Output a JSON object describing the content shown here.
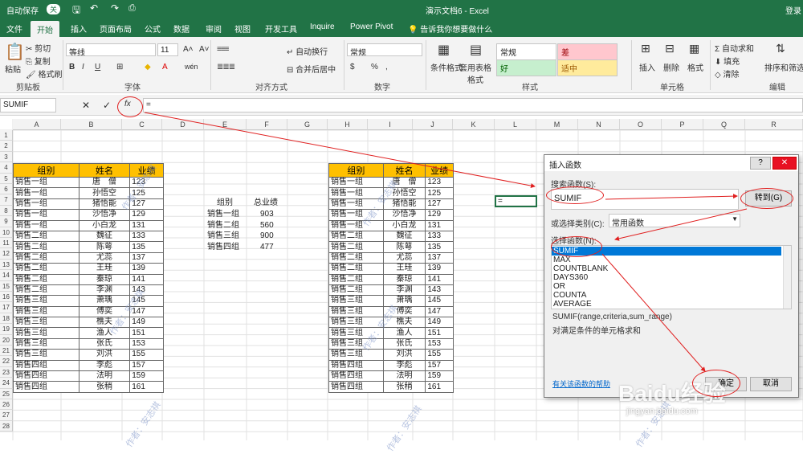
{
  "titlebar": {
    "autosave": "自动保存",
    "autosave_state": "关",
    "doc_title": "演示文档6  -  Excel",
    "login": "登录"
  },
  "tabs": [
    "文件",
    "开始",
    "插入",
    "页面布局",
    "公式",
    "数据",
    "审阅",
    "视图",
    "开发工具",
    "Inquire",
    "Power Pivot",
    "告诉我你想要做什么"
  ],
  "ribbon": {
    "clipboard": {
      "paste": "粘贴",
      "cut": "剪切",
      "copy": "复制",
      "format_painter": "格式刷",
      "group": "剪贴板"
    },
    "font": {
      "name": "等线",
      "size": "11",
      "group": "字体",
      "bold": "B",
      "italic": "I",
      "underline": "U",
      "grow": "A˄",
      "shrink": "A˅",
      "wen": "wén"
    },
    "alignment": {
      "wrap": "自动换行",
      "merge": "合并后居中",
      "group": "对齐方式"
    },
    "number": {
      "format": "常规",
      "group": "数字",
      "percent": "%",
      "comma": ","
    },
    "styles": {
      "conditional": "条件格式",
      "table": "套用表格格式",
      "normal": "常规",
      "bad": "差",
      "good": "好",
      "neutral": "适中",
      "group": "样式"
    },
    "cells": {
      "insert": "插入",
      "delete": "删除",
      "format": "格式",
      "group": "单元格"
    },
    "editing": {
      "autosum": "自动求和",
      "fill": "填充",
      "clear": "清除",
      "sort": "排序和筛选",
      "group": "编辑"
    }
  },
  "formula_bar": {
    "name_box": "SUMIF",
    "cancel": "✕",
    "enter": "✓",
    "fx": "fx",
    "content": "="
  },
  "columns": [
    "A",
    "B",
    "C",
    "D",
    "E",
    "F",
    "G",
    "H",
    "I",
    "J",
    "K",
    "L",
    "M",
    "N",
    "O",
    "P",
    "Q",
    "R"
  ],
  "rows": [
    "1",
    "2",
    "3",
    "4",
    "5",
    "6",
    "7",
    "8",
    "9",
    "10",
    "11",
    "12",
    "13",
    "14",
    "15",
    "16",
    "17",
    "18",
    "19",
    "20",
    "21",
    "22",
    "23",
    "24",
    "25",
    "26",
    "27",
    "28"
  ],
  "table_headers": [
    "组别",
    "姓名",
    "业绩"
  ],
  "table_rows": [
    [
      "销售一组",
      "唐　僧",
      "123"
    ],
    [
      "销售一组",
      "孙悟空",
      "125"
    ],
    [
      "销售一组",
      "猪悟能",
      "127"
    ],
    [
      "销售一组",
      "沙悟净",
      "129"
    ],
    [
      "销售一组",
      "小白龙",
      "131"
    ],
    [
      "销售二组",
      "魏征",
      "133"
    ],
    [
      "销售二组",
      "陈萼",
      "135"
    ],
    [
      "销售二组",
      "尤蕊",
      "137"
    ],
    [
      "销售二组",
      "王珪",
      "139"
    ],
    [
      "销售二组",
      "秦琼",
      "141"
    ],
    [
      "销售二组",
      "李渊",
      "143"
    ],
    [
      "销售三组",
      "萧瑀",
      "145"
    ],
    [
      "销售三组",
      "傅奕",
      "147"
    ],
    [
      "销售三组",
      "樵夫",
      "149"
    ],
    [
      "销售三组",
      "渔人",
      "151"
    ],
    [
      "销售三组",
      "张氏",
      "153"
    ],
    [
      "销售三组",
      "刘洪",
      "155"
    ],
    [
      "销售四组",
      "李彪",
      "157"
    ],
    [
      "销售四组",
      "法明",
      "159"
    ],
    [
      "销售四组",
      "张稍",
      "161"
    ]
  ],
  "summary": {
    "headers": [
      "组别",
      "总业绩"
    ],
    "rows": [
      [
        "销售一组",
        "903"
      ],
      [
        "销售二组",
        "560"
      ],
      [
        "销售三组",
        "900"
      ],
      [
        "销售四组",
        "477"
      ]
    ]
  },
  "active_cell": "=",
  "dialog": {
    "title": "插入函数",
    "help": "?",
    "close": "✕",
    "search_label": "搜索函数(S):",
    "search_value": "SUMIF",
    "go": "转到(G)",
    "category_label": "或选择类别(C):",
    "category_value": "常用函数",
    "select_label": "选择函数(N):",
    "functions": [
      "SUMIF",
      "MAX",
      "COUNTBLANK",
      "DAYS360",
      "OR",
      "COUNTA",
      "AVERAGE"
    ],
    "signature": "SUMIF(range,criteria,sum_range)",
    "description": "对满足条件的单元格求和",
    "help_link": "有关该函数的帮助",
    "ok": "确定",
    "cancel": "取消"
  },
  "watermark": "作者：安志祺",
  "baidu": {
    "logo": "Baidu经验",
    "url": "jingyan.baidu.com"
  },
  "colors": {
    "excel_green": "#217346",
    "header_fill": "#ffc000",
    "annotation": "#e02020"
  }
}
